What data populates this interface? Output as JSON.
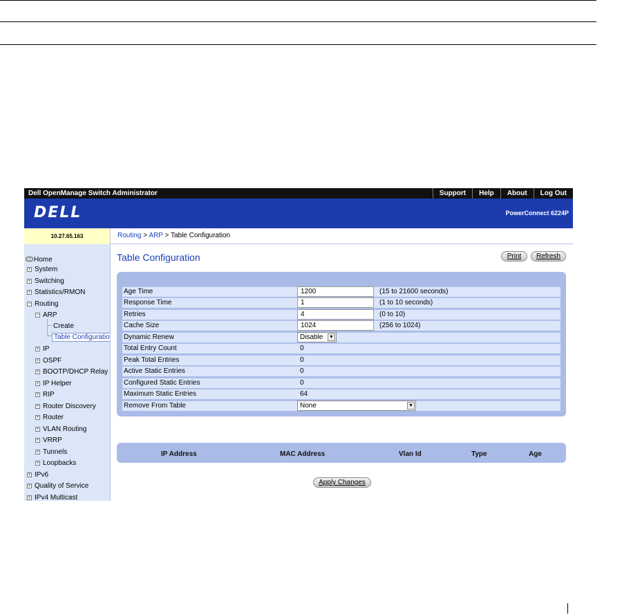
{
  "topbar": {
    "app_title": "Dell OpenManage Switch Administrator",
    "links": [
      "Support",
      "Help",
      "About",
      "Log Out"
    ]
  },
  "banner": {
    "logo": "DELL",
    "product": "PowerConnect 6224P"
  },
  "ip_address": "10.27.65.163",
  "breadcrumb": {
    "routing": "Routing",
    "sep1": ">",
    "arp": "ARP",
    "sep2": ">",
    "current": "Table Configuration"
  },
  "nav": {
    "home": "Home",
    "system": "System",
    "switching": "Switching",
    "stats": "Statistics/RMON",
    "routing": "Routing",
    "arp": "ARP",
    "create": "Create",
    "table_config": "Table Configuration",
    "ip": "IP",
    "ospf": "OSPF",
    "bootp": "BOOTP/DHCP Relay A",
    "ip_helper": "IP Helper",
    "rip": "RIP",
    "router_discovery": "Router Discovery",
    "router": "Router",
    "vlan_routing": "VLAN Routing",
    "vrrp": "VRRP",
    "tunnels": "Tunnels",
    "loopbacks": "Loopbacks",
    "ipv6": "IPv6",
    "qos": "Quality of Service",
    "ipv4_multicast": "IPv4 Multicast"
  },
  "page_title": "Table Configuration",
  "buttons": {
    "print": "Print",
    "refresh": "Refresh",
    "apply": "Apply Changes"
  },
  "form": {
    "age_time": {
      "label": "Age Time",
      "value": "1200",
      "hint": "(15 to 21600 seconds)"
    },
    "response_time": {
      "label": "Response Time",
      "value": "1",
      "hint": "(1 to 10 seconds)"
    },
    "retries": {
      "label": "Retries",
      "value": "4",
      "hint": "(0 to 10)"
    },
    "cache_size": {
      "label": "Cache Size",
      "value": "1024",
      "hint": "(256 to 1024)"
    },
    "dynamic_renew": {
      "label": "Dynamic Renew",
      "value": "Disable"
    },
    "total_entry_count": {
      "label": "Total Entry Count",
      "value": "0"
    },
    "peak_total_entries": {
      "label": "Peak Total Entries",
      "value": "0"
    },
    "active_static_entries": {
      "label": "Active Static Entries",
      "value": "0"
    },
    "configured_static_entries": {
      "label": "Configured Static Entries",
      "value": "0"
    },
    "maximum_static_entries": {
      "label": "Maximum Static Entries",
      "value": "64"
    },
    "remove_from_table": {
      "label": "Remove From Table",
      "value": "None"
    }
  },
  "table_headers": [
    "IP Address",
    "MAC Address",
    "Vlan Id",
    "Type",
    "Age"
  ]
}
